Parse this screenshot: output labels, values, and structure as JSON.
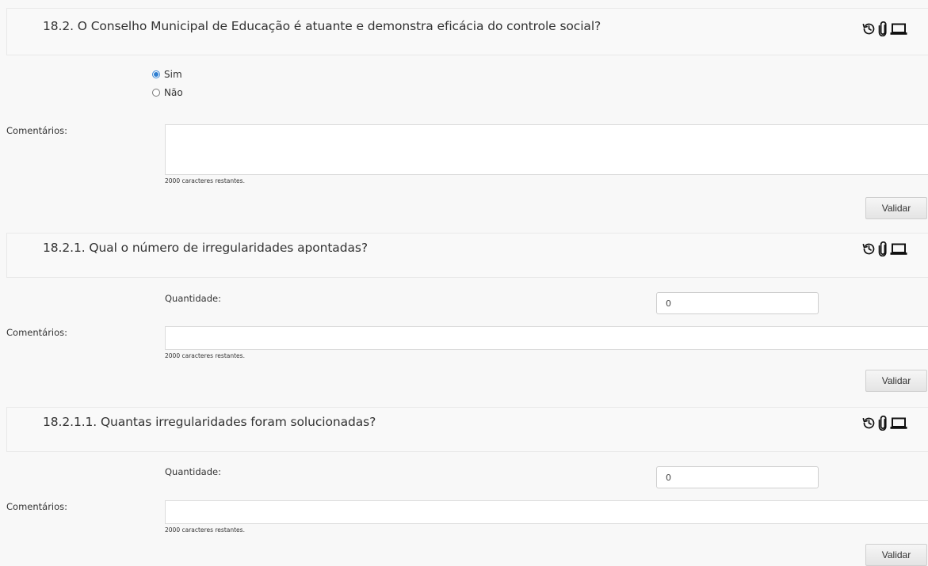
{
  "questions": [
    {
      "title": "18.2. O Conselho Municipal de Educação é atuante e demonstra eficácia do controle social?",
      "options": [
        {
          "label": "Sim",
          "selected": true
        },
        {
          "label": "Não",
          "selected": false
        }
      ],
      "comments_label": "Comentários:",
      "comments_value": "",
      "counter": "2000 caracteres restantes.",
      "validate_label": "Validar"
    },
    {
      "title": "18.2.1. Qual o número de irregularidades apontadas?",
      "quantity_label": "Quantidade:",
      "quantity_value": "0",
      "comments_label": "Comentários:",
      "comments_value": "",
      "counter": "2000 caracteres restantes.",
      "validate_label": "Validar"
    },
    {
      "title": "18.2.1.1. Quantas irregularidades foram solucionadas?",
      "quantity_label": "Quantidade:",
      "quantity_value": "0",
      "comments_label": "Comentários:",
      "comments_value": "",
      "counter": "2000 caracteres restantes.",
      "validate_label": "Validar"
    }
  ],
  "header_icons": [
    "history-icon",
    "paperclip-icon",
    "laptop-icon"
  ],
  "colors": {
    "radio_selected": "#2f7fd1",
    "background": "#f8f8f8"
  }
}
